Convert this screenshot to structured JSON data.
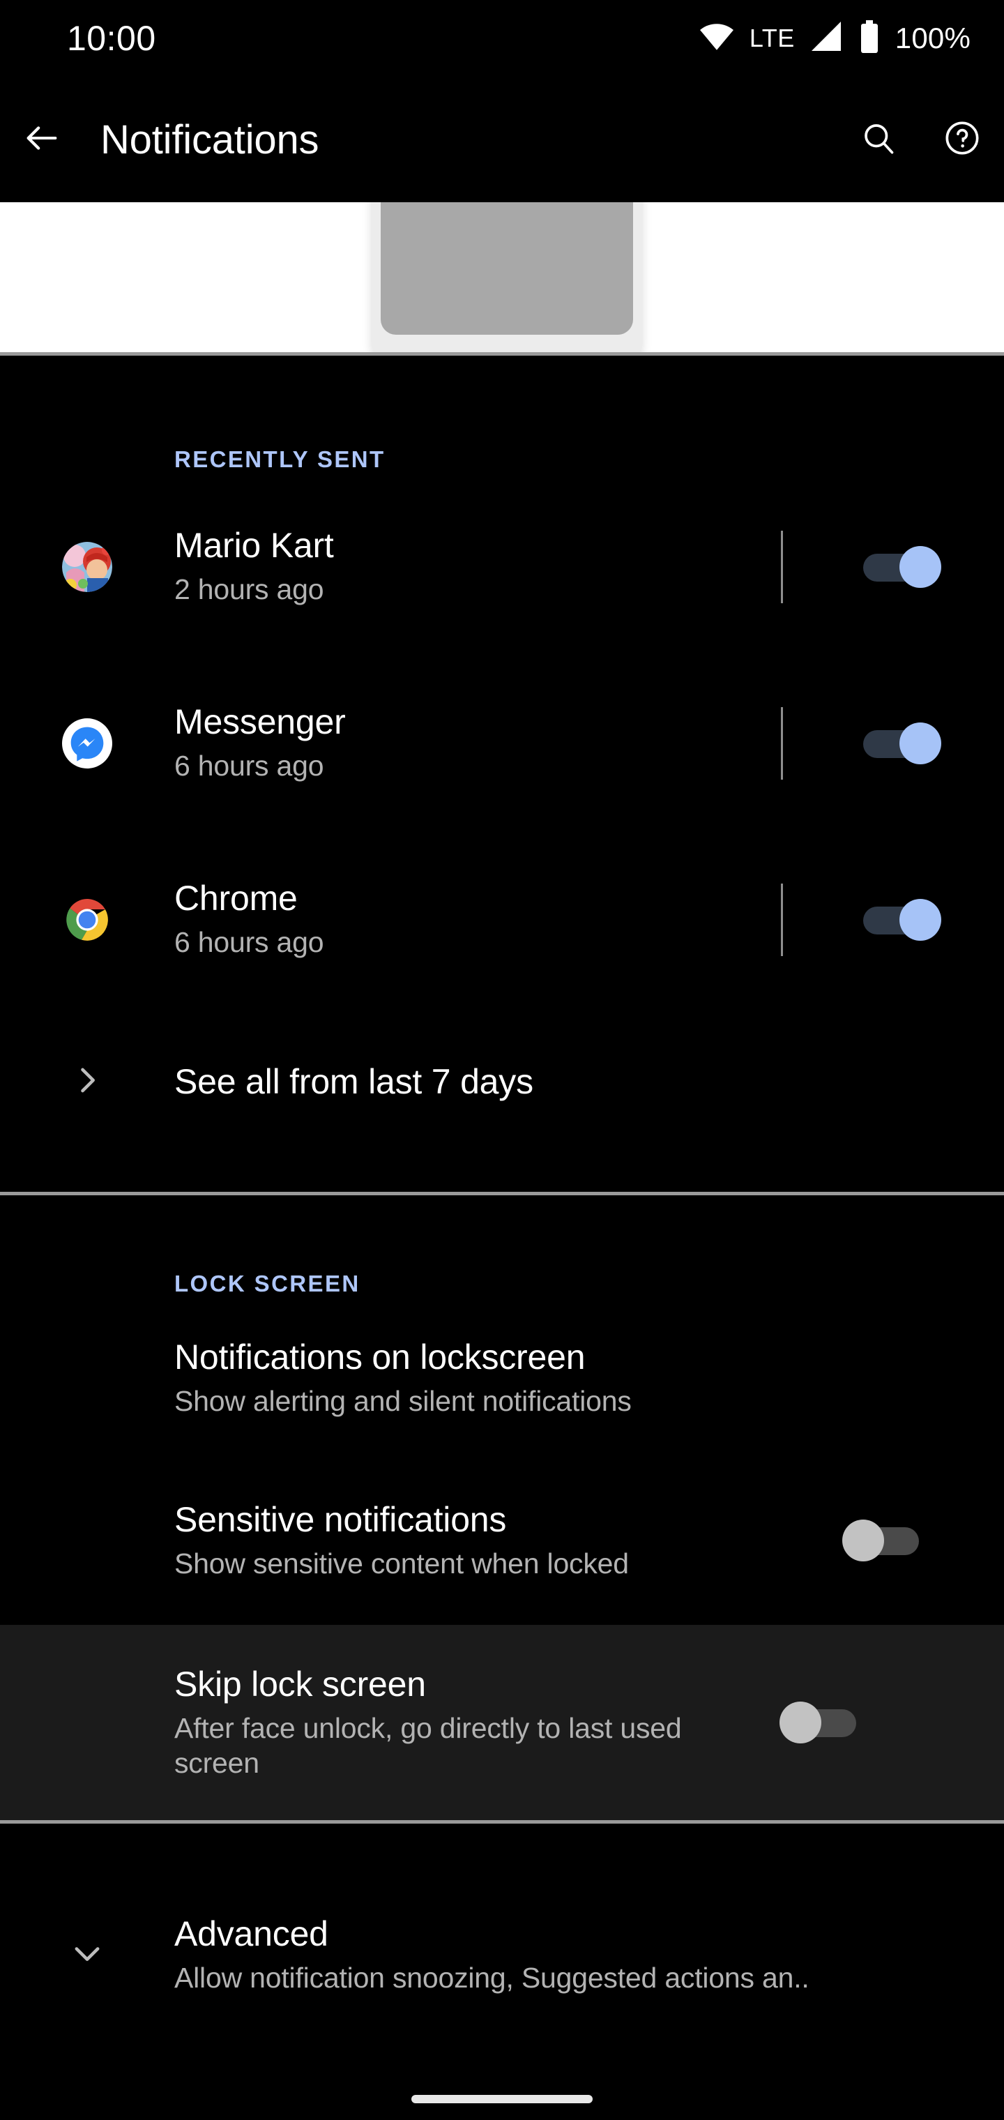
{
  "status_bar": {
    "clock": "10:00",
    "network_label": "LTE",
    "battery_percent": "100%",
    "icons": [
      "wifi-icon",
      "signal-icon",
      "battery-icon"
    ]
  },
  "app_bar": {
    "title": "Notifications",
    "back_icon": "back-arrow-icon",
    "search_icon": "search-icon",
    "help_icon": "help-icon"
  },
  "illustration": {
    "alt": "phone-illustration"
  },
  "recently_sent": {
    "header": "RECENTLY SENT",
    "items": [
      {
        "app": "Mario Kart",
        "time": "2 hours ago",
        "icon": "mario-kart-icon",
        "toggle": "on"
      },
      {
        "app": "Messenger",
        "time": "6 hours ago",
        "icon": "messenger-icon",
        "toggle": "on"
      },
      {
        "app": "Chrome",
        "time": "6 hours ago",
        "icon": "chrome-icon",
        "toggle": "on"
      }
    ],
    "see_all": {
      "label": "See all from last 7 days",
      "icon": "chevron-right-icon"
    }
  },
  "lock_screen": {
    "header": "LOCK SCREEN",
    "items": [
      {
        "title": "Notifications on lockscreen",
        "subtitle": "Show alerting and silent notifications",
        "has_toggle": false
      },
      {
        "title": "Sensitive notifications",
        "subtitle": "Show sensitive content when locked",
        "has_toggle": true,
        "toggle": "off"
      },
      {
        "title": "Skip lock screen",
        "subtitle": "After face unlock, go directly to last used screen",
        "has_toggle": true,
        "toggle": "off",
        "highlighted": true
      }
    ]
  },
  "advanced": {
    "title": "Advanced",
    "subtitle": "Allow notification snoozing, Suggested actions an..",
    "icon": "chevron-down-icon"
  },
  "colors": {
    "background": "#000000",
    "section_header": "#aec6f9",
    "primary_text": "#ffffff",
    "secondary_text": "#b3b3b3",
    "divider": "#9a9a9a",
    "toggle_on_thumb": "#a6c3f7",
    "toggle_on_track": "#2f3947",
    "toggle_off_thumb": "#c2c2c2",
    "toggle_off_track": "#4a4a4a",
    "highlight_row": "#1b1b1b"
  }
}
